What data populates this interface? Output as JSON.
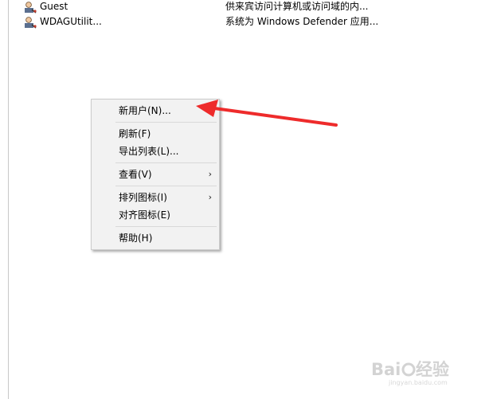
{
  "users": [
    {
      "name": "Guest",
      "description": "供来宾访问计算机或访问域的内...",
      "icon": "user-icon"
    },
    {
      "name": "WDAGUtilit...",
      "description": "系统为 Windows Defender 应用...",
      "icon": "user-icon"
    }
  ],
  "context_menu": {
    "items": [
      {
        "label": "新用户(N)...",
        "submenu": false
      },
      {
        "label": "刷新(F)",
        "submenu": false
      },
      {
        "label": "导出列表(L)...",
        "submenu": false
      },
      {
        "label": "查看(V)",
        "submenu": true
      },
      {
        "label": "排列图标(I)",
        "submenu": true
      },
      {
        "label": "对齐图标(E)",
        "submenu": false
      },
      {
        "label": "帮助(H)",
        "submenu": false
      }
    ]
  },
  "colors": {
    "annotation_arrow": "#ee2b2b",
    "menu_background": "#f2f2f2"
  }
}
